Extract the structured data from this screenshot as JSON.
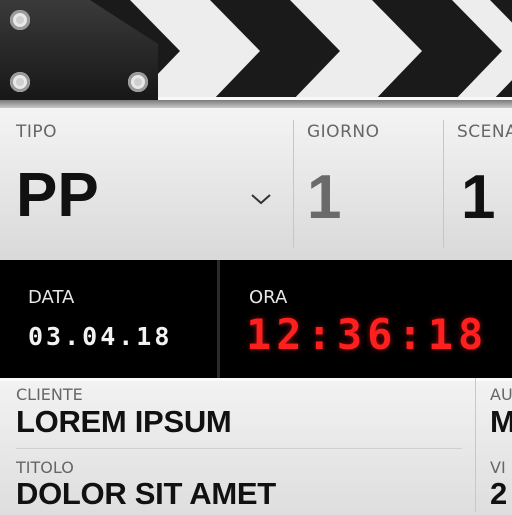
{
  "slate": {
    "tipo": {
      "label": "TIPO",
      "value": "PP"
    },
    "giorno": {
      "label": "GIORNO",
      "value": "1"
    },
    "scena": {
      "label": "SCENA",
      "value": "1"
    }
  },
  "display": {
    "data": {
      "label": "DATA",
      "value": "03.04.18"
    },
    "ora": {
      "label": "ORA",
      "value": "12:36:18"
    },
    "colors": {
      "time": "#ff1f1f",
      "date": "#f2f2f2",
      "band": "#000000"
    }
  },
  "details": {
    "cliente": {
      "label": "CLIENTE",
      "value": "LOREM IPSUM"
    },
    "titolo": {
      "label": "TITOLO",
      "value": "DOLOR SIT AMET"
    },
    "right_col": {
      "label_top": "AU",
      "value_top": "M",
      "label_bottom": "VI",
      "value_bottom": "2"
    }
  },
  "icons": {
    "dropdown": "chevron-down-icon",
    "screw": "screw-icon"
  }
}
